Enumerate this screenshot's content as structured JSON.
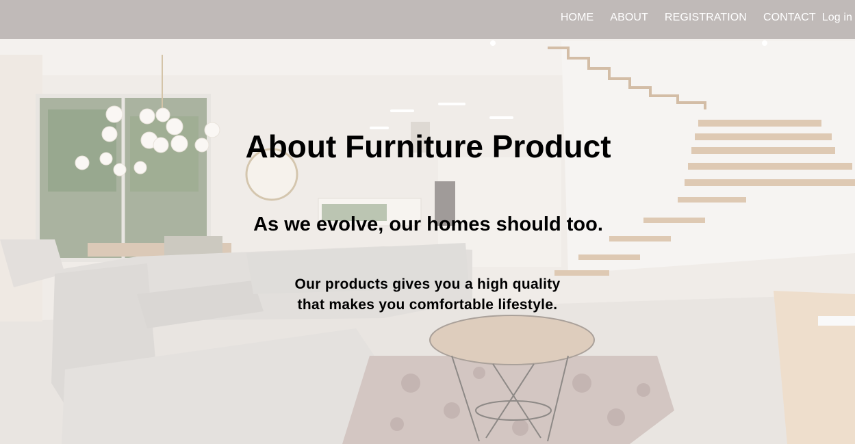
{
  "nav": {
    "items": [
      "HOME",
      "ABOUT",
      "REGISTRATION",
      "CONTACT"
    ],
    "login_label": "Log in"
  },
  "hero": {
    "title": "About Furniture Product",
    "subtitle": "As we evolve, our homes should too.",
    "body_line1": "Our products gives you a high quality",
    "body_line2": "that makes you comfortable lifestyle."
  },
  "colors": {
    "nav_text": "#ffffff",
    "nav_background": "#968c8c",
    "heading_text": "#000000"
  }
}
